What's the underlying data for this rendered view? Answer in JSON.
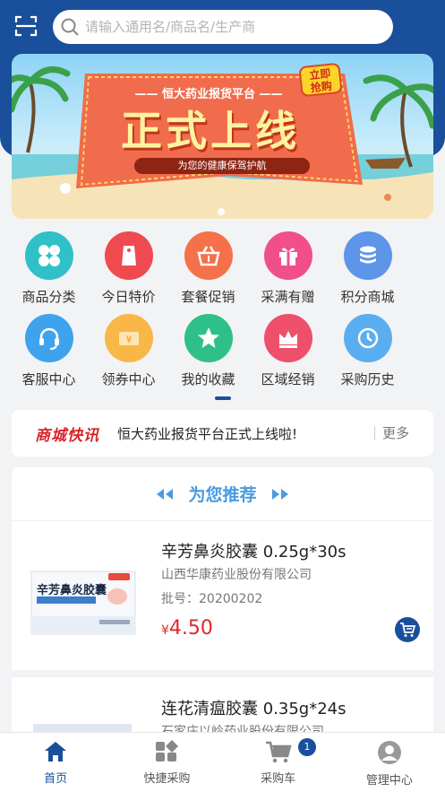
{
  "search": {
    "placeholder": "请输入通用名/商品名/生产商"
  },
  "banner": {
    "subtitle": "—— 恒大药业报货平台 ——",
    "title": "正式上线",
    "slogan": "为您的健康保驾护航",
    "badge_line1": "立即",
    "badge_line2": "抢购"
  },
  "grid": {
    "row1": [
      {
        "label": "商品分类",
        "icon": "category-icon",
        "color": "#2fc0c8"
      },
      {
        "label": "今日特价",
        "icon": "tag-icon",
        "color": "#ef4a4f"
      },
      {
        "label": "套餐促销",
        "icon": "basket-icon",
        "color": "#f4714b"
      },
      {
        "label": "采满有赠",
        "icon": "gift-icon",
        "color": "#f04f8c"
      },
      {
        "label": "积分商城",
        "icon": "coins-icon",
        "color": "#5d95e9"
      }
    ],
    "row2": [
      {
        "label": "客服中心",
        "icon": "headset-icon",
        "color": "#3ea3ec"
      },
      {
        "label": "领券中心",
        "icon": "coupon-icon",
        "color": "#f9b748"
      },
      {
        "label": "我的收藏",
        "icon": "star-icon",
        "color": "#2fc08a"
      },
      {
        "label": "区域经销",
        "icon": "crown-icon",
        "color": "#ee4f6b"
      },
      {
        "label": "采购历史",
        "icon": "clock-icon",
        "color": "#5aaef0"
      }
    ]
  },
  "news": {
    "logo": "商城快讯",
    "text": "恒大药业报货平台正式上线啦!",
    "more": "更多"
  },
  "recommend": {
    "title": "为您推荐",
    "products": [
      {
        "name": "辛芳鼻炎胶囊 0.25g*30s",
        "maker": "山西华康药业股份有限公司",
        "batch": "批号：20200202",
        "currency": "¥",
        "price": "4.50",
        "box_text": "辛芳鼻炎胶囊"
      },
      {
        "name": "连花清瘟胶囊 0.35g*24s",
        "maker": "石家庄以岭药业股份有限公司"
      }
    ]
  },
  "tabbar": {
    "home": "首页",
    "quick": "快捷采购",
    "cart": "采购车",
    "cart_count": "1",
    "manage": "管理中心"
  },
  "colors": {
    "brand": "#1a4f9c",
    "price": "#e0272b",
    "accent": "#4a9be0"
  }
}
